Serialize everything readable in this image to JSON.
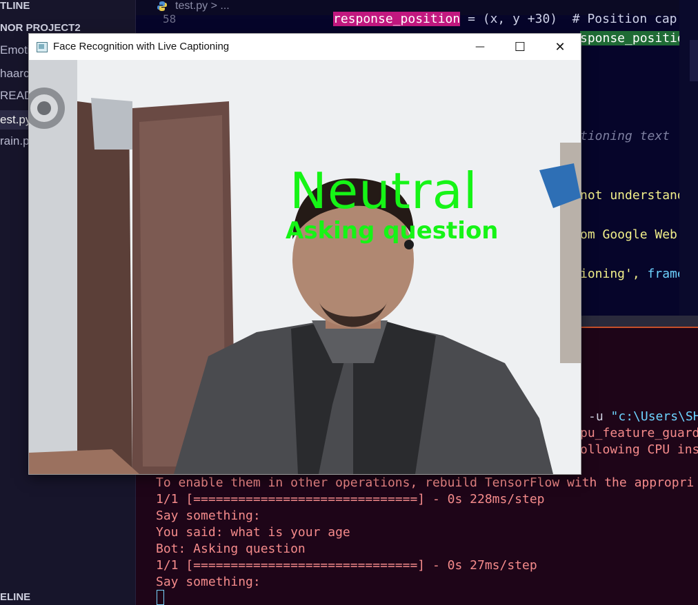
{
  "sidebar": {
    "outline_label": "TLINE",
    "project_label": "NOR PROJECT2",
    "files": [
      "Emoti",
      "haarca",
      "READ",
      "est.py",
      "rain.p"
    ],
    "timeline_label": "ELINE"
  },
  "editor": {
    "tab_file": "test.py",
    "tab_crumb": "> ...",
    "line_number": "58",
    "line58_var": "response_position",
    "line58_rest": " = (x, y +30)  # Position cap",
    "line59_frag": "sponse_position",
    "frag_captioning_text": "tioning text",
    "frag_not_understand": "not understand",
    "frag_google": "om Google Web S",
    "frag_ioning": "ioning', ",
    "frag_frame": "frame)"
  },
  "terminal": {
    "frag_run_cmd": "-u ",
    "frag_run_path": "\"c:\\Users\\SH",
    "frag_cpu_guard": "pu_feature_guard",
    "frag_cpu_ins": "ollowing CPU ins",
    "lines": [
      "To enable them in other operations, rebuild TensorFlow with the appropri",
      "1/1 [==============================] - 0s 228ms/step",
      "Say something:",
      "You said: what is your age",
      "Bot: Asking question",
      "1/1 [==============================] - 0s 27ms/step",
      "Say something:"
    ]
  },
  "window": {
    "title": "Face Recognition with Live Captioning",
    "minimize_glyph": "—",
    "maximize_glyph": "☐",
    "close_glyph": "✕",
    "emotion_caption": "Neutral",
    "bot_caption": "Asking question"
  }
}
